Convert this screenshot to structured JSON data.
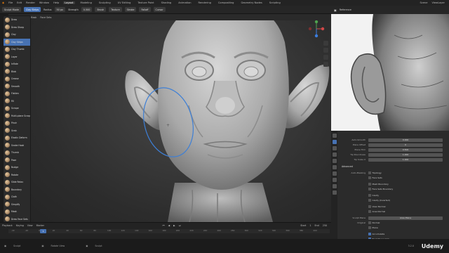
{
  "menubar": {
    "items": [
      "File",
      "Edit",
      "Render",
      "Window",
      "Help"
    ],
    "workspaces": [
      "Layout",
      "Modeling",
      "Sculpting",
      "UV Editing",
      "Texture Paint",
      "Shading",
      "Animation",
      "Rendering",
      "Compositing",
      "Geometry Nodes",
      "Scripting"
    ],
    "active_workspace": "Layout",
    "scene": "Scene",
    "view_layer": "ViewLayer"
  },
  "toolheader": {
    "mode": "Sculpt Mode",
    "brush": "Clay Strips",
    "radius_label": "Radius",
    "radius_value": "50 px",
    "strength_label": "Strength",
    "strength_value": "0.500",
    "brush_menu": "Brush",
    "texture_menu": "Texture",
    "stroke_menu": "Stroke",
    "falloff_menu": "Falloff",
    "cursor_menu": "Cursor",
    "view_menu": "View",
    "symmetry": "Symmetry"
  },
  "section_header": {
    "items": [
      "View",
      "Sculpt",
      "Mask",
      "Face Sets"
    ]
  },
  "brushes": [
    {
      "label": "Draw",
      "selected": false
    },
    {
      "label": "Draw Sharp",
      "selected": false
    },
    {
      "label": "Clay",
      "selected": false
    },
    {
      "label": "Clay Strips",
      "selected": true
    },
    {
      "label": "Clay Thumb",
      "selected": false
    },
    {
      "label": "Layer",
      "selected": false
    },
    {
      "label": "Inflate",
      "selected": false
    },
    {
      "label": "Blob",
      "selected": false
    },
    {
      "label": "Crease",
      "selected": false
    },
    {
      "label": "Smooth",
      "selected": false
    },
    {
      "label": "Flatten",
      "selected": false
    },
    {
      "label": "Fill",
      "selected": false
    },
    {
      "label": "Scrape",
      "selected": false
    },
    {
      "label": "Multi-plane Scrape",
      "selected": false
    },
    {
      "label": "Pinch",
      "selected": false
    },
    {
      "label": "Grab",
      "selected": false
    },
    {
      "label": "Elastic Deform",
      "selected": false
    },
    {
      "label": "Snake Hook",
      "selected": false
    },
    {
      "label": "Thumb",
      "selected": false
    },
    {
      "label": "Pose",
      "selected": false
    },
    {
      "label": "Nudge",
      "selected": false
    },
    {
      "label": "Rotate",
      "selected": false
    },
    {
      "label": "Slide Relax",
      "selected": false
    },
    {
      "label": "Boundary",
      "selected": false
    },
    {
      "label": "Cloth",
      "selected": false
    },
    {
      "label": "Simplify",
      "selected": false
    },
    {
      "label": "Mask",
      "selected": false
    },
    {
      "label": "Draw Face Sets",
      "selected": false
    }
  ],
  "reference_panel": {
    "title": "Reference"
  },
  "properties": {
    "rows": [
      {
        "label": "Auto-Smooth",
        "value": "0.000"
      },
      {
        "label": "Plane Offset",
        "value": "0"
      },
      {
        "label": "Plane Trim",
        "value": "0.500"
      },
      {
        "label": "Tip Roundness",
        "value": "1.000"
      },
      {
        "label": "Tip Scale X",
        "value": "1.000"
      }
    ],
    "advanced_header": "Advanced",
    "auto_masking_label": "Auto-Masking",
    "auto_masking_options": [
      {
        "label": "Topology",
        "on": false
      },
      {
        "label": "Face Sets",
        "on": false
      },
      {
        "label": "Mesh Boundary",
        "on": false
      },
      {
        "label": "Face Sets Boundary",
        "on": false
      },
      {
        "label": "Cavity",
        "on": false
      },
      {
        "label": "Cavity (Inverted)",
        "on": false
      },
      {
        "label": "View Normal",
        "on": false
      },
      {
        "label": "Area Normal",
        "on": false
      }
    ],
    "sculpt_plane_label": "Sculpt Plane",
    "sculpt_plane_value": "Area Plane",
    "original_label": "Original",
    "original_options": [
      {
        "label": "Normal",
        "on": false
      },
      {
        "label": "Plane",
        "on": false
      }
    ],
    "accumulate": {
      "label": "Accumulate",
      "on": true
    },
    "front_faces": {
      "label": "Front Faces Only",
      "on": true
    }
  },
  "timeline": {
    "header": [
      "Playback",
      "Keying",
      "View",
      "Marker"
    ],
    "current_frame": "1",
    "start_label": "Start",
    "start_value": "1",
    "end_label": "End",
    "end_value": "250",
    "ticks": [
      "-40",
      "-20",
      "0",
      "20",
      "40",
      "60",
      "80",
      "100",
      "120",
      "140",
      "160",
      "180",
      "200",
      "220",
      "240",
      "260",
      "280",
      "300",
      "320",
      "340",
      "360",
      "380",
      "400"
    ]
  },
  "statusbar": {
    "items": [
      "Sculpt",
      "Rotate View",
      "Sculpt"
    ],
    "version": "3.2.0"
  },
  "watermark": "Udemy",
  "colors": {
    "accent": "#4772b3",
    "clay": "#b8b8b8",
    "brush_circle": "#3d7fd6"
  }
}
